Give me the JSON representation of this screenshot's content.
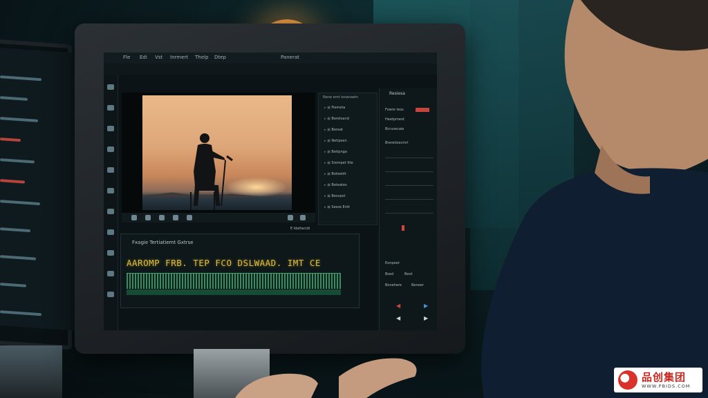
{
  "scene": {
    "description_colors": {
      "wall": "#1d5a5f",
      "lamp": "#f2a044",
      "accent_red": "#c2463b",
      "waveform_green": "#3bbd7a",
      "caption_yellow": "#e0bd3c"
    }
  },
  "editor": {
    "menubar": [
      "Fle",
      "Edi",
      "Vst",
      "Inrmert",
      "Thelp",
      "Dtep"
    ],
    "title": "Panerat",
    "browser": {
      "title": "Nene emt ienanaetn",
      "items": [
        "Fiemeta",
        "Beretsand",
        "Bereat",
        "Netipsen",
        "Betipnga",
        "Srempet Itte",
        "Boteeidt",
        "Beteates",
        "Bexvpst",
        "Sesse Entt"
      ]
    },
    "inspector": {
      "title": "Resiesa",
      "rows": [
        "Fowre tess",
        "Heetpmeot",
        "Bcrusecaie",
        "Breretsiecmrl",
        "Eonpeet",
        "Bsed",
        "Beot",
        "Bonehere",
        "Beneer"
      ]
    },
    "timeline": {
      "header": "Fxagie Tertiatiemt Gxtrse",
      "caption": "AAROMP  FRB. TEP  FCO  DSLWAAD.  IMT  CE",
      "track_label": "E Idattacidi"
    }
  },
  "watermark": {
    "brand": "品创集团",
    "url": "WWW.PBIDS.COM"
  }
}
